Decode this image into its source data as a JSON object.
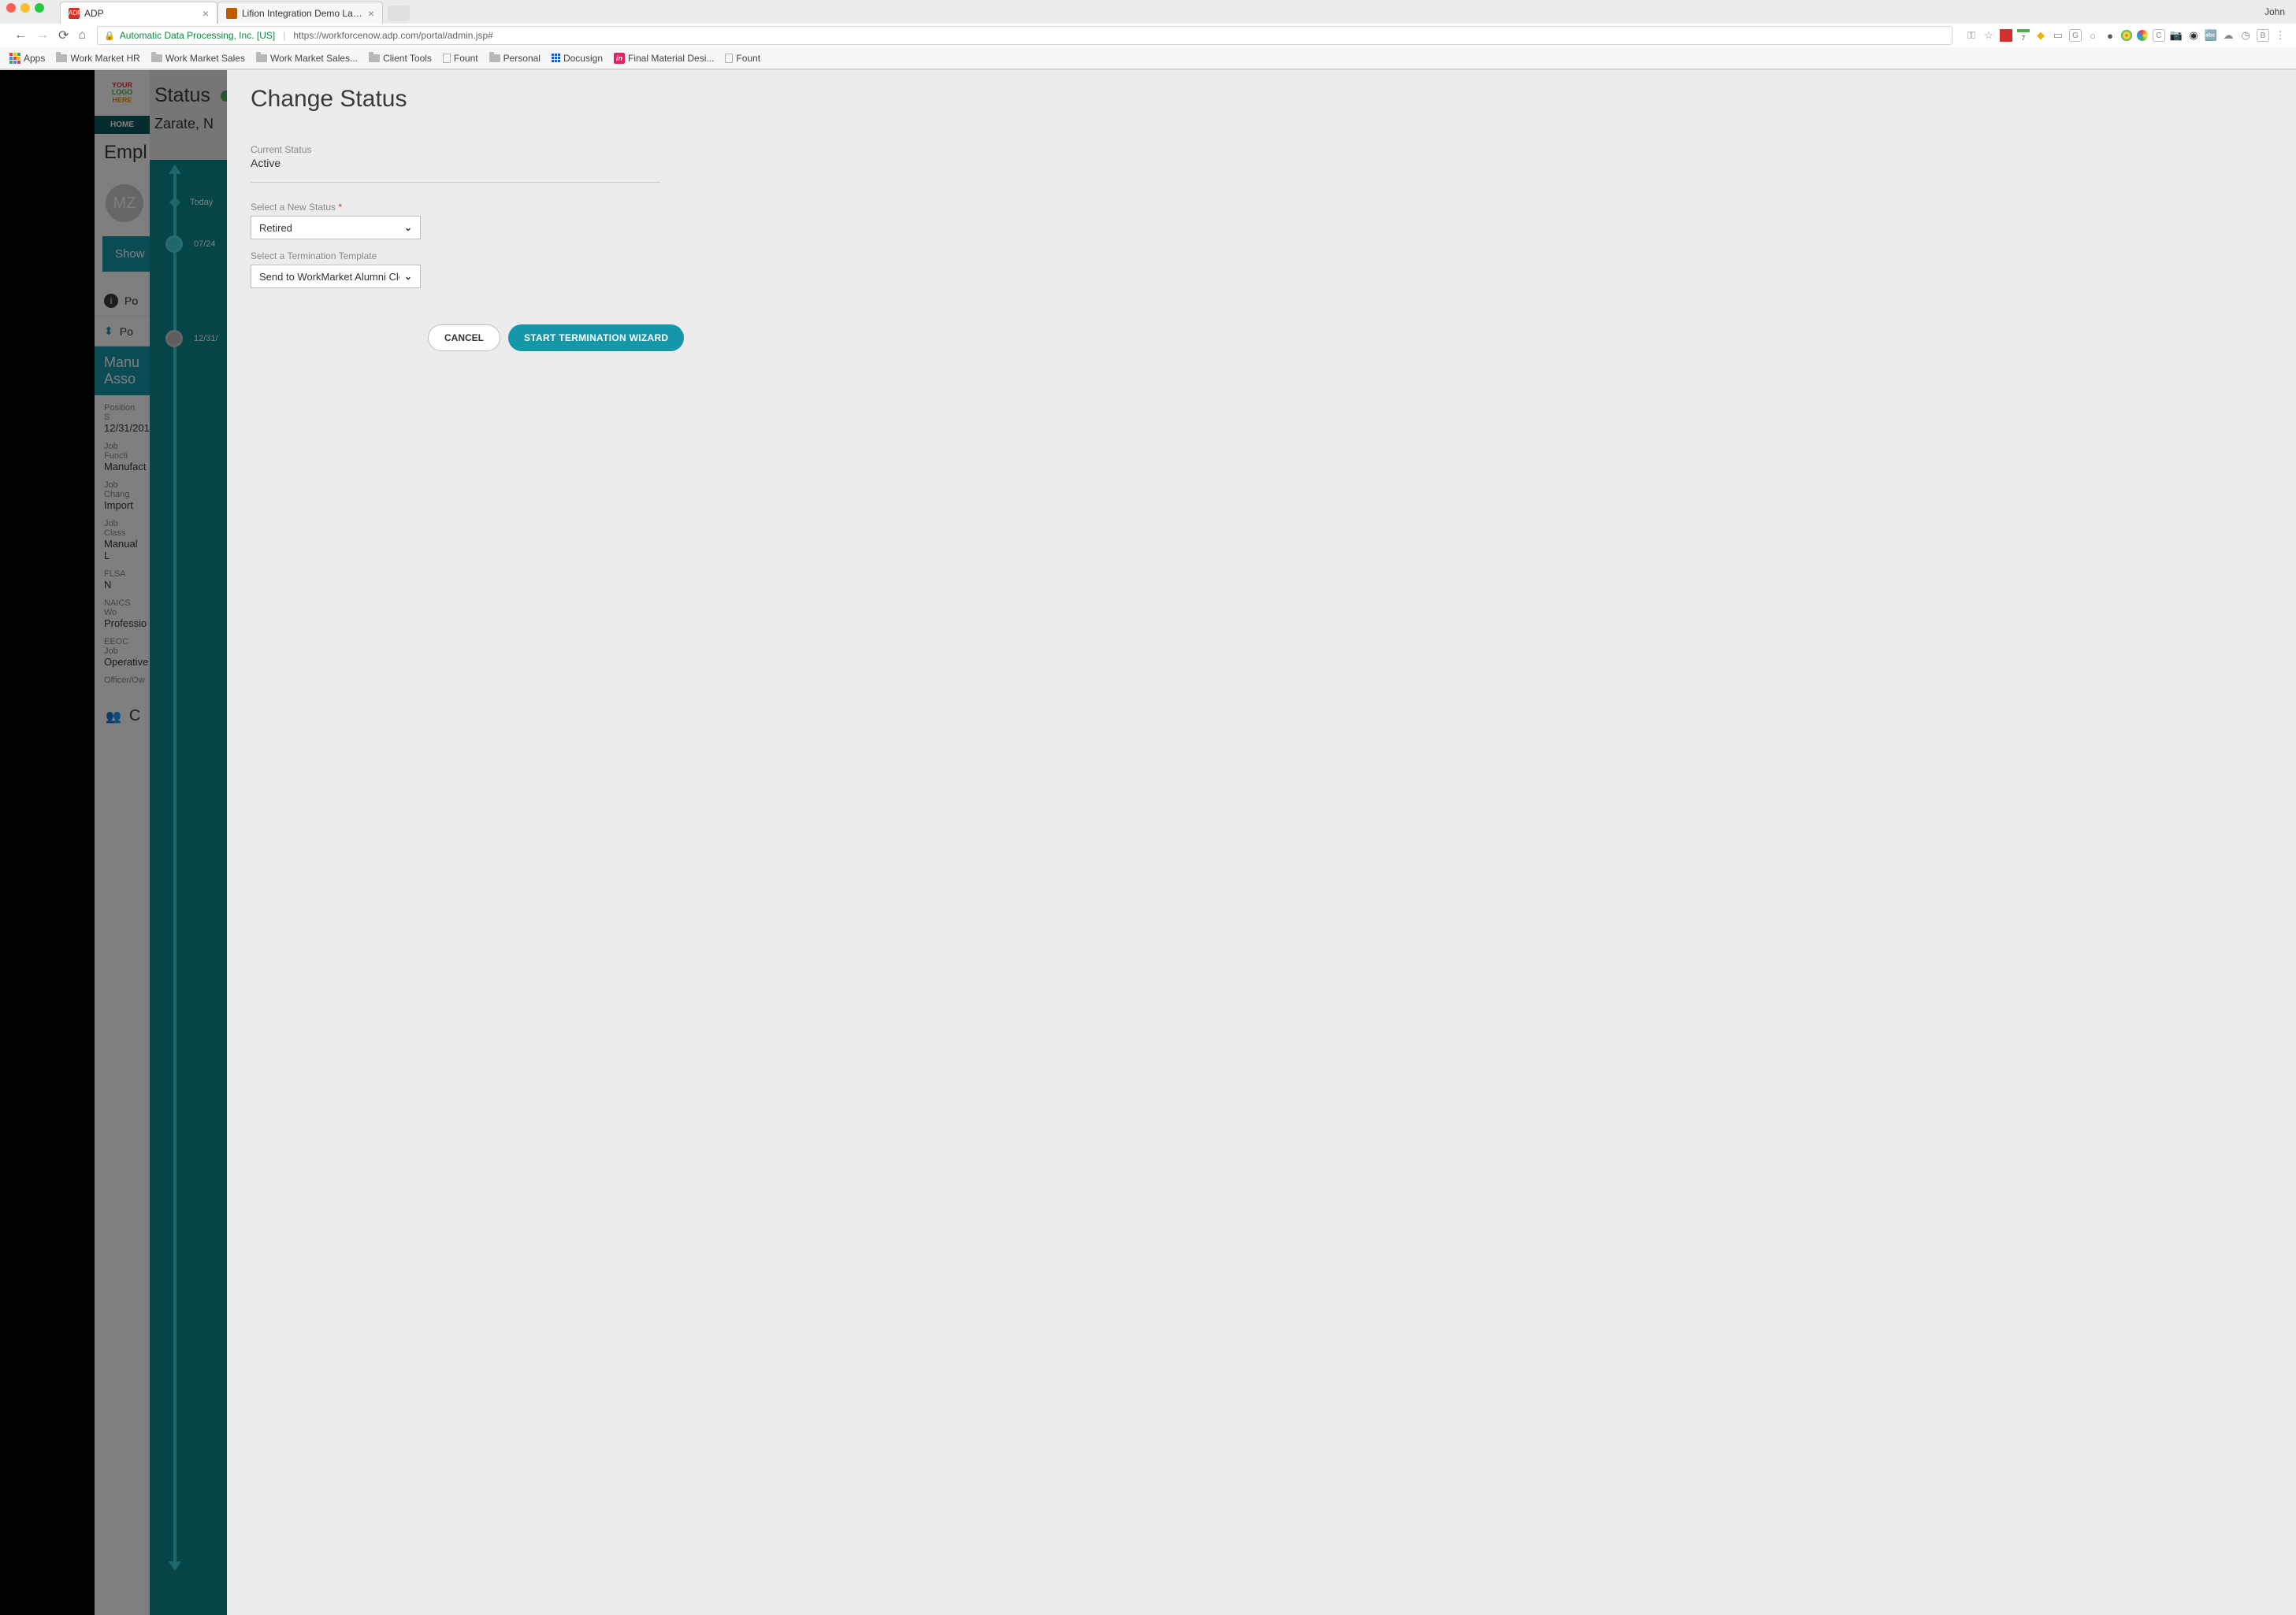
{
  "browser": {
    "profile_name": "John",
    "tabs": [
      {
        "title": "ADP",
        "favicon_bg": "#d93025",
        "favicon_text": "ADP",
        "active": true
      },
      {
        "title": "Lifion Integration Demo Labor",
        "favicon_bg": "#c05a00",
        "favicon_text": "",
        "active": false
      }
    ],
    "url_org": "Automatic Data Processing, Inc. [US]",
    "url": "https://workforcenow.adp.com/portal/admin.jsp#",
    "bookmarks": {
      "apps": "Apps",
      "items": [
        {
          "type": "folder",
          "label": "Work Market HR"
        },
        {
          "type": "folder",
          "label": "Work Market Sales"
        },
        {
          "type": "folder",
          "label": "Work Market Sales..."
        },
        {
          "type": "folder",
          "label": "Client Tools"
        },
        {
          "type": "doc",
          "label": "Fount"
        },
        {
          "type": "folder",
          "label": "Personal"
        },
        {
          "type": "docusign",
          "label": "Docusign"
        },
        {
          "type": "invision",
          "label": "Final Material Desi..."
        },
        {
          "type": "doc",
          "label": "Fount"
        }
      ]
    }
  },
  "app_background": {
    "logo_placeholder_lines": [
      "YOUR",
      "LOGO",
      "HERE"
    ],
    "home": "HOME",
    "empl_heading": "Empl",
    "avatar_initials": "MZ",
    "show_button": "Show",
    "position_link_1": "Po",
    "position_link_2": "Po",
    "blue_box_line1": "Manu",
    "blue_box_line2": "Asso",
    "fields": [
      {
        "label": "Position S",
        "value": "12/31/201"
      },
      {
        "label": "Job Functi",
        "value": "Manufact"
      },
      {
        "label": "Job Chang",
        "value": "Import"
      },
      {
        "label": "Job Class",
        "value": "Manual L"
      },
      {
        "label": "FLSA",
        "value": "N"
      },
      {
        "label": "NAICS Wo",
        "value": "Professio"
      },
      {
        "label": "EEOC Job",
        "value": "Operative"
      },
      {
        "label": "Officer/Ow",
        "value": ""
      }
    ],
    "bottom_letter": "C"
  },
  "timeline": {
    "status_heading": "Status",
    "employee_name": "Zarate, N",
    "nodes": {
      "today": "Today",
      "node1": "07/24",
      "node2": "12/31/"
    }
  },
  "modal": {
    "title": "Change Status",
    "current_status_label": "Current Status",
    "current_status_value": "Active",
    "new_status_label": "Select a New Status",
    "new_status_value": "Retired",
    "template_label": "Select a Termination Template",
    "template_value": "Send to WorkMarket Alumni Cloud",
    "cancel": "CANCEL",
    "primary": "START TERMINATION WIZARD"
  }
}
